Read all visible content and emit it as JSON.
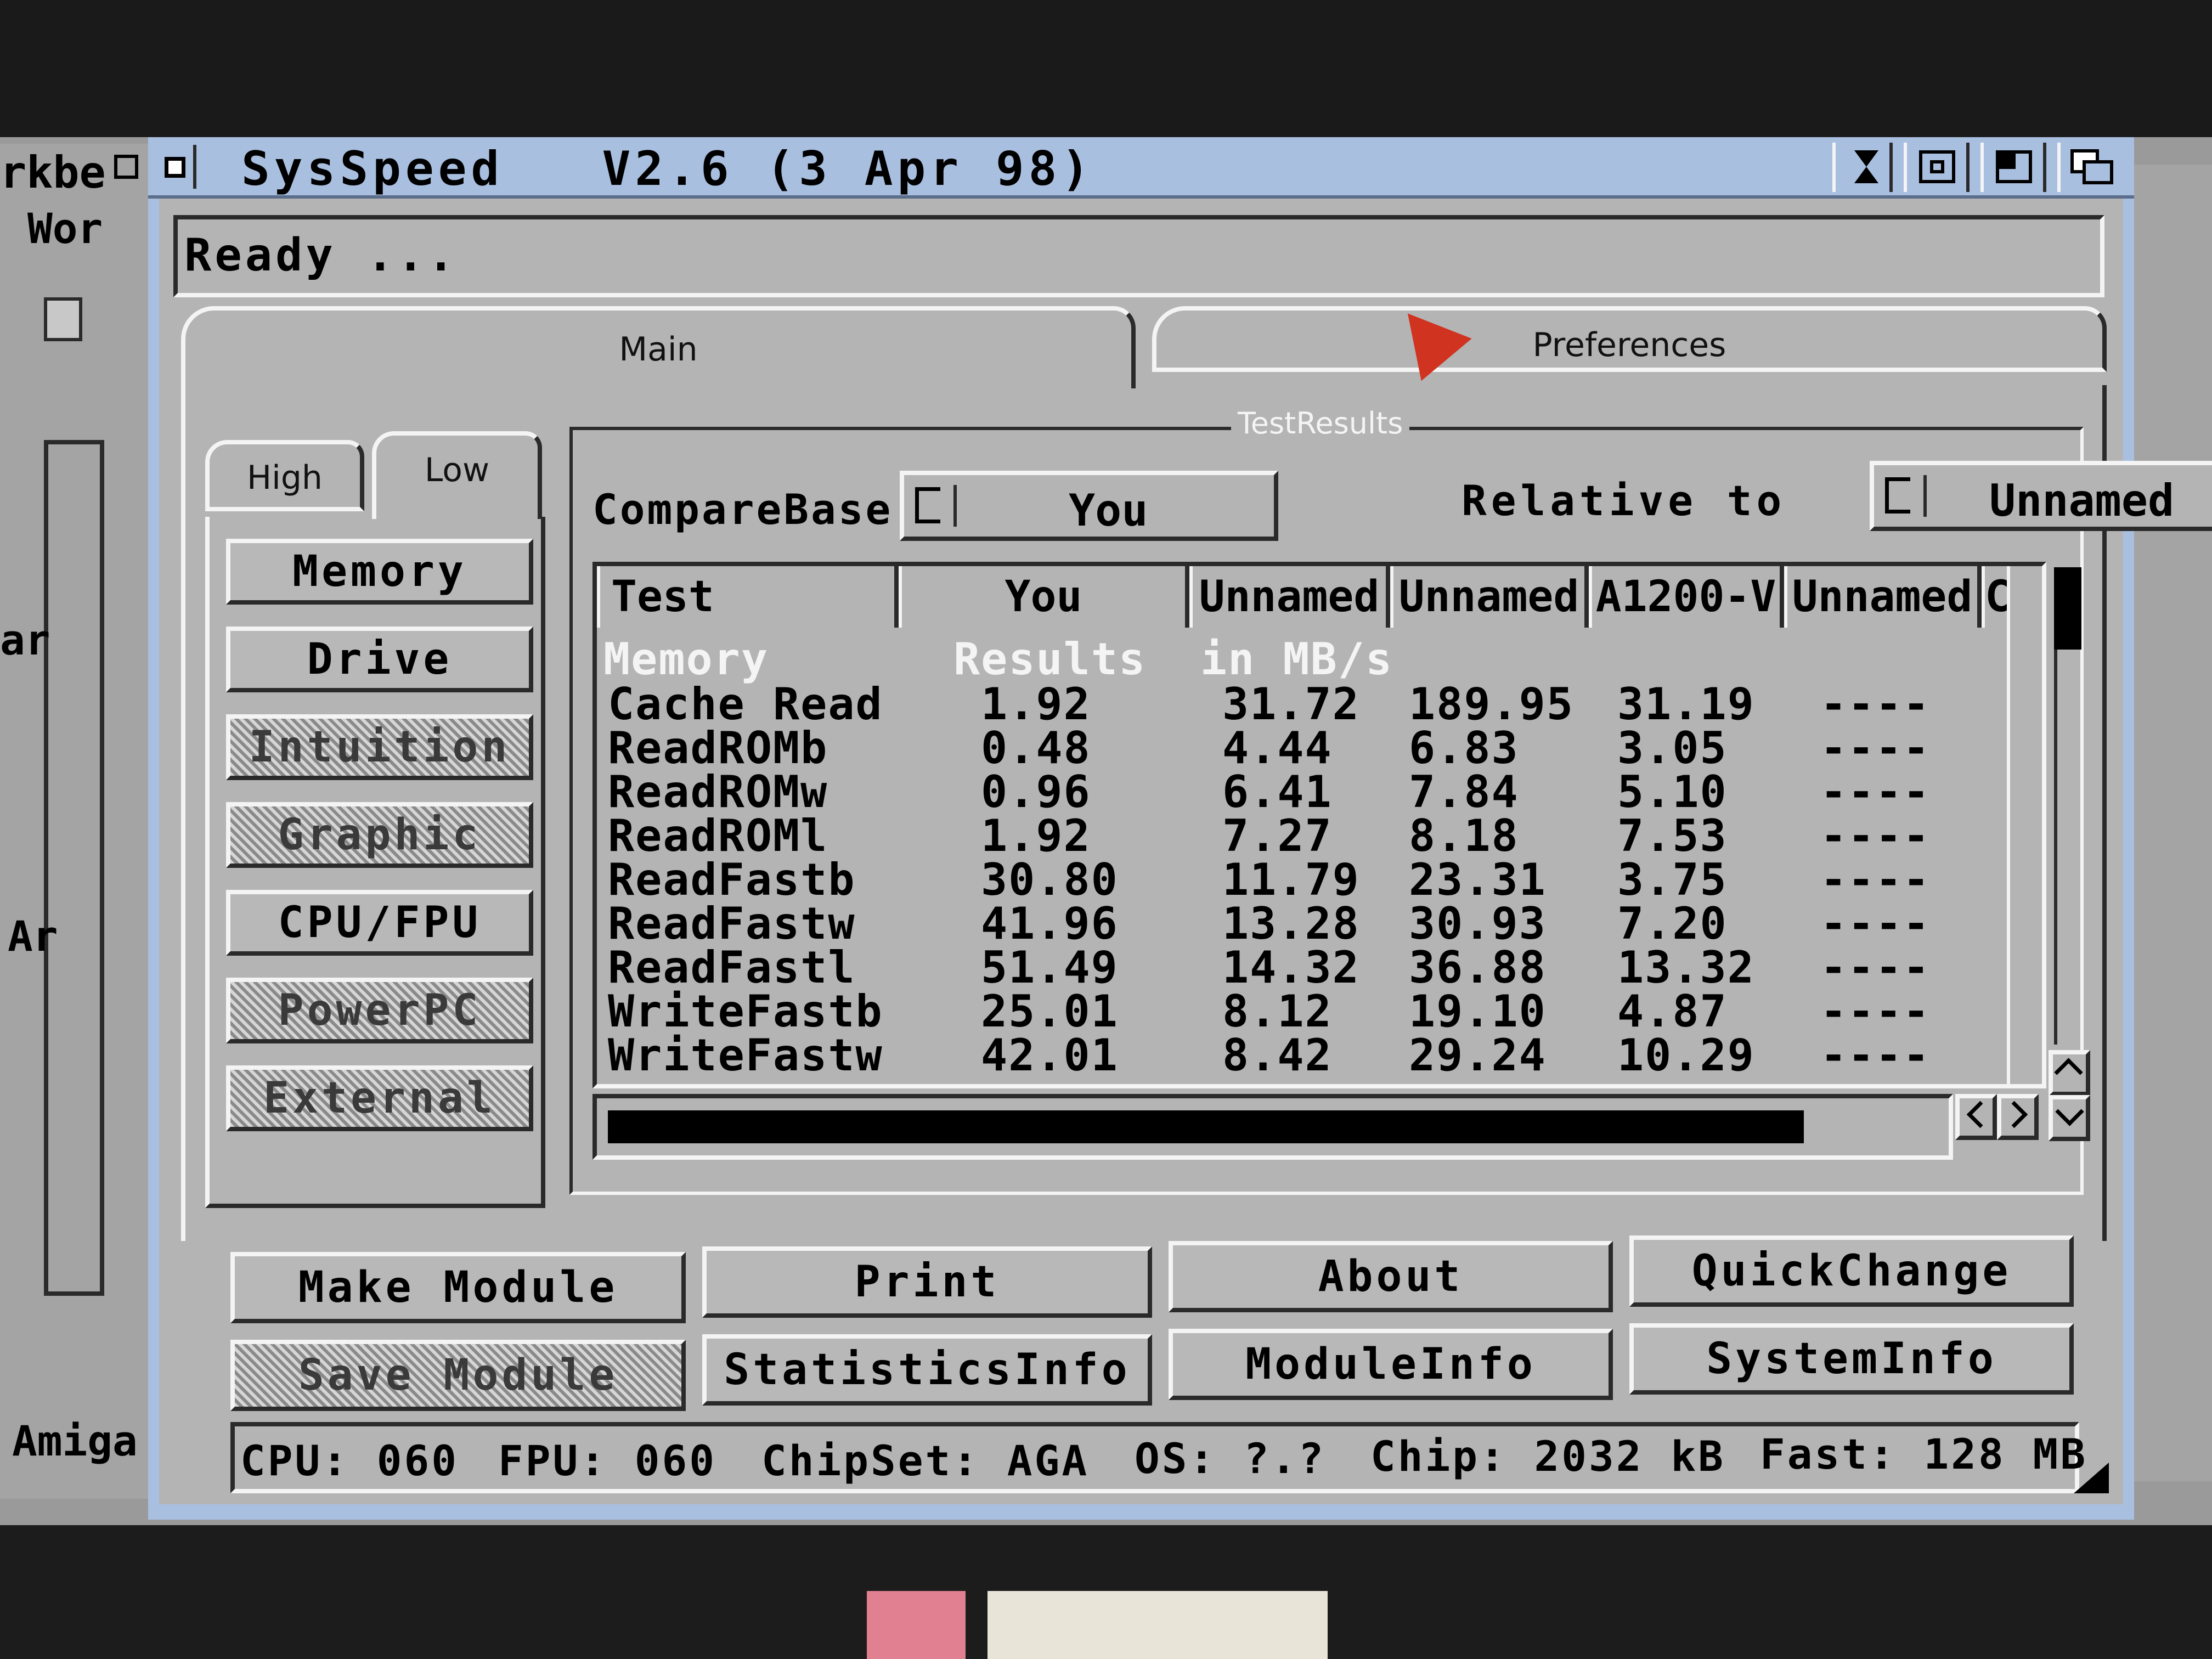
{
  "window": {
    "title": "SysSpeed   V2.6 (3 Apr 98)"
  },
  "background_windows": {
    "left_title": "rkbe",
    "left_label_wor": "Wor",
    "left_label_ar": "ar",
    "left_label_ar2": "Ar",
    "left_label_amiga": "Amiga"
  },
  "status": {
    "text": "Ready ..."
  },
  "tabs": [
    {
      "label": "Main"
    },
    {
      "label": "Preferences"
    }
  ],
  "subtabs": [
    {
      "label": "High"
    },
    {
      "label": "Low"
    }
  ],
  "categories": [
    {
      "label": "Memory",
      "enabled": true
    },
    {
      "label": "Drive",
      "enabled": true
    },
    {
      "label": "Intuition",
      "enabled": false
    },
    {
      "label": "Graphic",
      "enabled": false
    },
    {
      "label": "CPU/FPU",
      "enabled": true
    },
    {
      "label": "PowerPC",
      "enabled": false
    },
    {
      "label": "External",
      "enabled": false
    }
  ],
  "results": {
    "group_label": "TestResults",
    "compare_label": "CompareBase",
    "compare_value": "You",
    "relative_label": "Relative to",
    "relative_value": "Unnamed",
    "columns": [
      "Test",
      "You",
      "Unnamed",
      "Unnamed",
      "A1200-V",
      "Unnamed",
      "C"
    ],
    "section_header": [
      "Memory",
      "Results",
      "in MB/s"
    ],
    "rows": [
      [
        "Cache Read",
        "1.92",
        "31.72",
        "189.95",
        "31.19",
        "----"
      ],
      [
        "ReadROMb",
        "0.48",
        "4.44",
        "6.83",
        "3.05",
        "----"
      ],
      [
        "ReadROMw",
        "0.96",
        "6.41",
        "7.84",
        "5.10",
        "----"
      ],
      [
        "ReadROMl",
        "1.92",
        "7.27",
        "8.18",
        "7.53",
        "----"
      ],
      [
        "ReadFastb",
        "30.80",
        "11.79",
        "23.31",
        "3.75",
        "----"
      ],
      [
        "ReadFastw",
        "41.96",
        "13.28",
        "30.93",
        "7.20",
        "----"
      ],
      [
        "ReadFastl",
        "51.49",
        "14.32",
        "36.88",
        "13.32",
        "----"
      ],
      [
        "WriteFastb",
        "25.01",
        "8.12",
        "19.10",
        "4.87",
        "----"
      ],
      [
        "WriteFastw",
        "42.01",
        "8.42",
        "29.24",
        "10.29",
        "----"
      ]
    ]
  },
  "buttons": [
    {
      "label": "Make Module",
      "enabled": true
    },
    {
      "label": "Print",
      "enabled": true
    },
    {
      "label": "About",
      "enabled": true
    },
    {
      "label": "QuickChange",
      "enabled": true
    },
    {
      "label": "Save Module",
      "enabled": false
    },
    {
      "label": "StatisticsInfo",
      "enabled": true
    },
    {
      "label": "ModuleInfo",
      "enabled": true
    },
    {
      "label": "SystemInfo",
      "enabled": true
    }
  ],
  "sysinfo": {
    "cpu": "CPU: 060",
    "fpu": "FPU: 060",
    "chipset": "ChipSet: AGA",
    "os": "OS: ?.?",
    "chip": "Chip: 2032 kB",
    "fast": "Fast: 128 MB"
  },
  "colors": {
    "titlebar": "#a9bfe0",
    "window_bg": "#b4b4b4",
    "pointer": "#d0331f"
  },
  "icons": [
    "close-icon",
    "depth-icon",
    "zoom-icon",
    "popup-icon",
    "scroll-up-icon",
    "scroll-down-icon",
    "scroll-left-icon",
    "scroll-right-icon",
    "size-icon",
    "mouse-pointer-icon"
  ]
}
